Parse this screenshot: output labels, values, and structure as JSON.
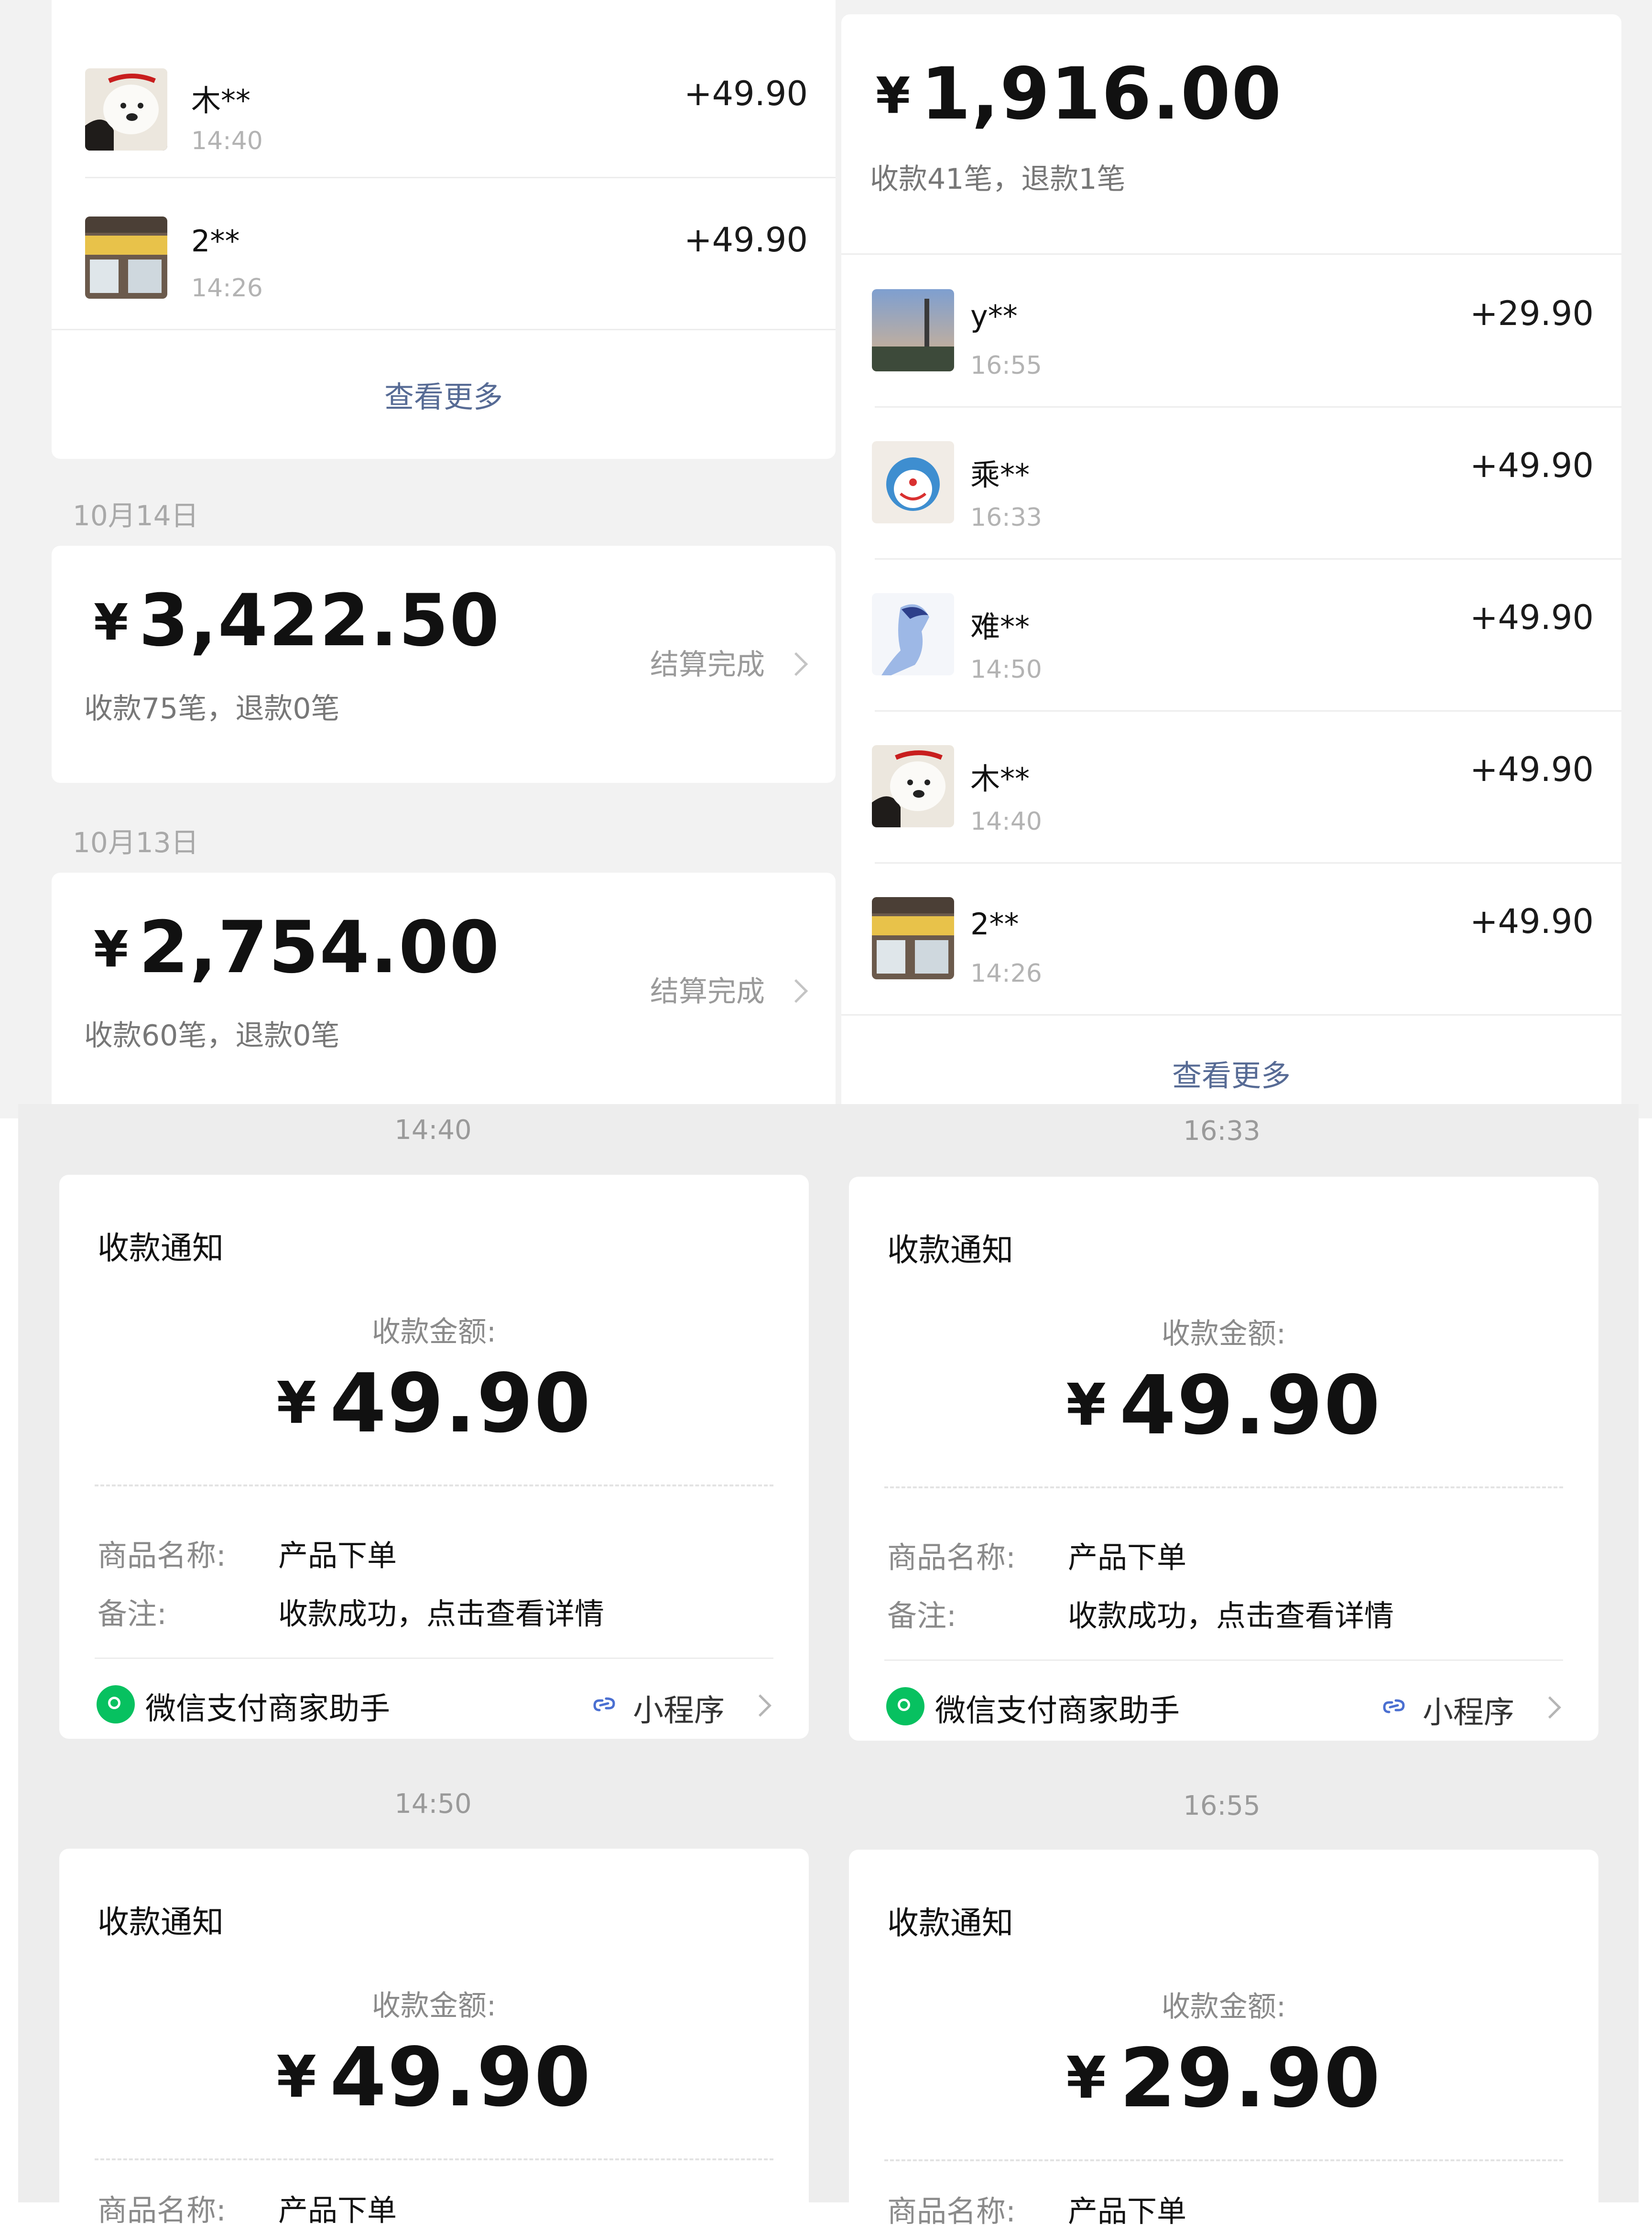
{
  "left_panel": {
    "top_card": {
      "rows": [
        {
          "name": "木**",
          "time": "14:40",
          "amount": "+49.90"
        },
        {
          "name": "2**",
          "time": "14:26",
          "amount": "+49.90"
        }
      ],
      "more_label": "查看更多"
    },
    "days": [
      {
        "date": "10月14日",
        "currency": "¥",
        "total": "3,422.50",
        "stats": "收款75笔，退款0笔",
        "status": "结算完成"
      },
      {
        "date": "10月13日",
        "currency": "¥",
        "total": "2,754.00",
        "stats": "收款60笔，退款0笔",
        "status": "结算完成"
      }
    ]
  },
  "right_panel": {
    "currency": "¥",
    "total": "1,916.00",
    "stats": "收款41笔，退款1笔",
    "rows": [
      {
        "name": "y**",
        "time": "16:55",
        "amount": "+29.90"
      },
      {
        "name": "乘**",
        "time": "16:33",
        "amount": "+49.90"
      },
      {
        "name": "难**",
        "time": "14:50",
        "amount": "+49.90"
      },
      {
        "name": "木**",
        "time": "14:40",
        "amount": "+49.90"
      },
      {
        "name": "2**",
        "time": "14:26",
        "amount": "+49.90"
      }
    ],
    "more_label": "查看更多"
  },
  "notifications": [
    {
      "timestamp": "14:40",
      "title": "收款通知",
      "amount_label": "收款金额:",
      "currency": "¥",
      "amount": "49.90",
      "product_key": "商品名称:",
      "product_value": "产品下单",
      "note_key": "备注:",
      "note_value": "收款成功，点击查看详情",
      "source": "微信支付商家助手",
      "mini_program": "小程序"
    },
    {
      "timestamp": "16:33",
      "title": "收款通知",
      "amount_label": "收款金额:",
      "currency": "¥",
      "amount": "49.90",
      "product_key": "商品名称:",
      "product_value": "产品下单",
      "note_key": "备注:",
      "note_value": "收款成功，点击查看详情",
      "source": "微信支付商家助手",
      "mini_program": "小程序"
    },
    {
      "timestamp": "14:50",
      "title": "收款通知",
      "amount_label": "收款金额:",
      "currency": "¥",
      "amount": "49.90",
      "product_key": "商品名称:",
      "product_value": "产品下单"
    },
    {
      "timestamp": "16:55",
      "title": "收款通知",
      "amount_label": "收款金额:",
      "currency": "¥",
      "amount": "29.90",
      "product_key": "商品名称:",
      "product_value": "产品下单"
    }
  ],
  "colors": {
    "accent_green": "#07c160",
    "link_blue": "#576b95"
  },
  "icons": [
    "avatar-photo",
    "chevron-right-icon",
    "wechat-pay-icon",
    "mini-program-link-icon"
  ]
}
